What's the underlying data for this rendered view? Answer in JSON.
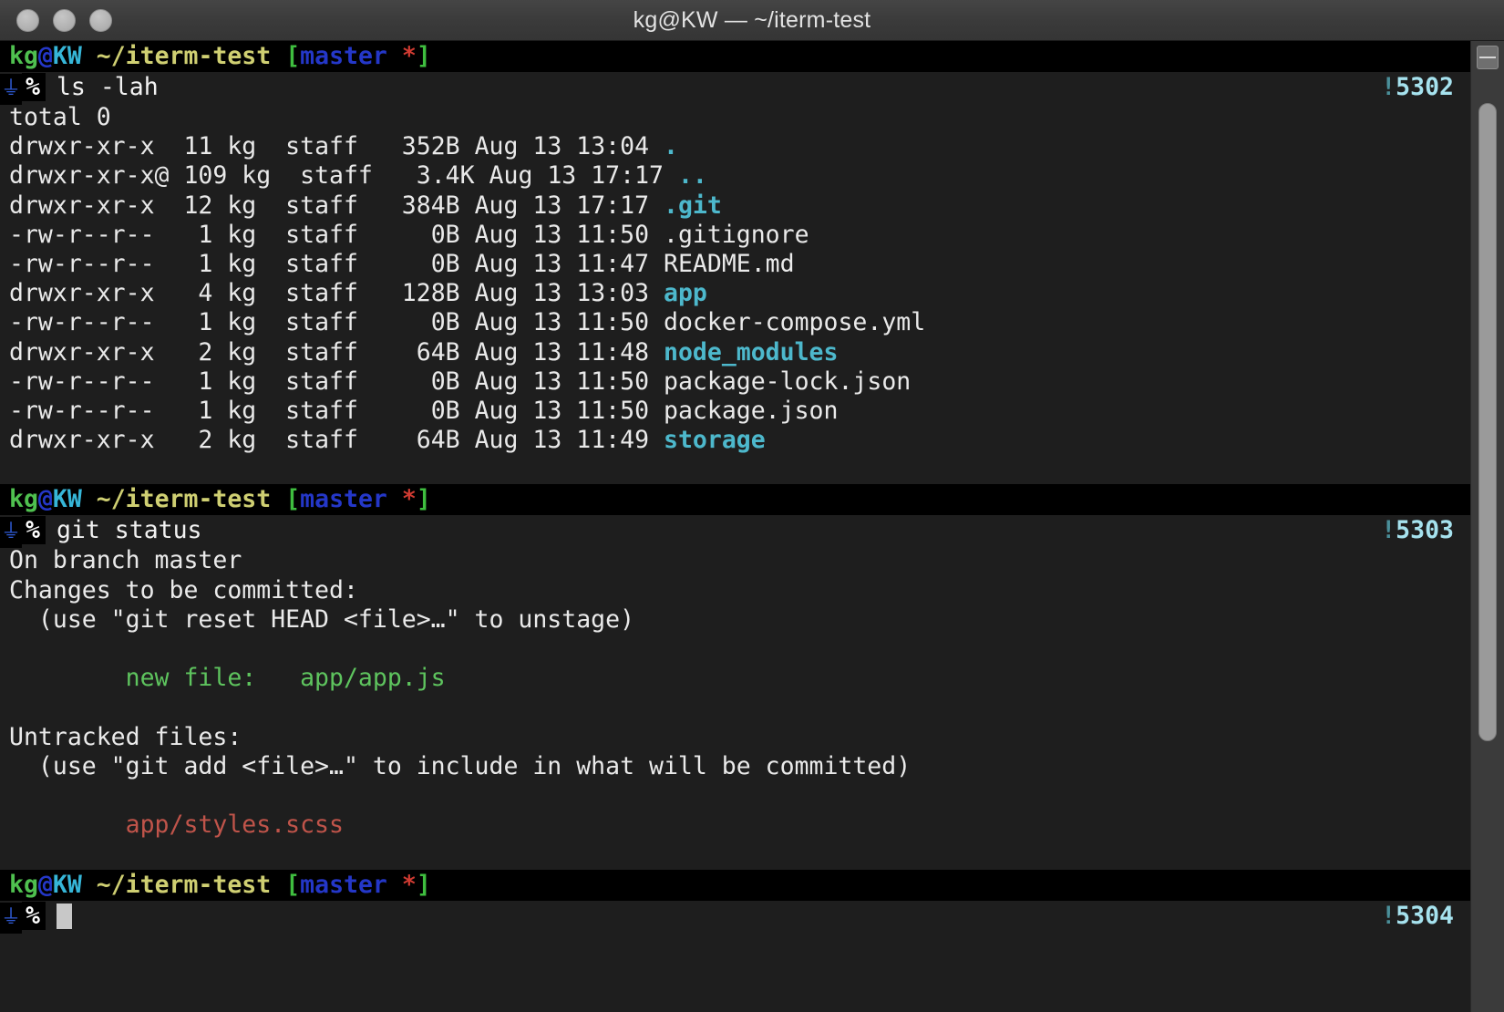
{
  "window": {
    "title": "kg@KW — ~/iterm-test",
    "traffic_lights": [
      "close",
      "minimize",
      "zoom"
    ]
  },
  "theme": {
    "titlebar_bg": "#3a3a3a",
    "terminal_bg": "#1e1e1e",
    "prompt_bg": "#000000",
    "foreground": "#e9e9e9",
    "dir_color": "#4db8cc",
    "green": "#5ec45e",
    "red": "#c0544a",
    "badge_color": "#a6e2ee",
    "cursor_color": "#c8c8c8"
  },
  "prompt": {
    "user": "kg",
    "at": "@",
    "host": "KW",
    "path": "~/iterm-test",
    "bracket_open": "[",
    "branch": "master",
    "dirty": "*",
    "bracket_close": "]",
    "mark": "⏚",
    "symbol": "%"
  },
  "blocks": [
    {
      "command": "ls -lah",
      "badge_bang": "!",
      "badge_num": "5302",
      "output": [
        {
          "text": "total 0",
          "color": "default"
        },
        {
          "perm": "drwxr-xr-x",
          "links": " 11",
          "user": "kg",
          "group": "staff",
          "size": " 352B",
          "date": "Aug 13 13:04",
          "name": ".",
          "name_color": "dir"
        },
        {
          "perm": "drwxr-xr-x@",
          "links": "109",
          "user": "kg",
          "group": "staff",
          "size": " 3.4K",
          "date": "Aug 13 17:17",
          "name": "..",
          "name_color": "dir"
        },
        {
          "perm": "drwxr-xr-x",
          "links": " 12",
          "user": "kg",
          "group": "staff",
          "size": " 384B",
          "date": "Aug 13 17:17",
          "name": ".git",
          "name_color": "dir"
        },
        {
          "perm": "-rw-r--r--",
          "links": "  1",
          "user": "kg",
          "group": "staff",
          "size": "   0B",
          "date": "Aug 13 11:50",
          "name": ".gitignore",
          "name_color": "file"
        },
        {
          "perm": "-rw-r--r--",
          "links": "  1",
          "user": "kg",
          "group": "staff",
          "size": "   0B",
          "date": "Aug 13 11:47",
          "name": "README.md",
          "name_color": "file"
        },
        {
          "perm": "drwxr-xr-x",
          "links": "  4",
          "user": "kg",
          "group": "staff",
          "size": " 128B",
          "date": "Aug 13 13:03",
          "name": "app",
          "name_color": "dir"
        },
        {
          "perm": "-rw-r--r--",
          "links": "  1",
          "user": "kg",
          "group": "staff",
          "size": "   0B",
          "date": "Aug 13 11:50",
          "name": "docker-compose.yml",
          "name_color": "file"
        },
        {
          "perm": "drwxr-xr-x",
          "links": "  2",
          "user": "kg",
          "group": "staff",
          "size": "  64B",
          "date": "Aug 13 11:48",
          "name": "node_modules",
          "name_color": "dir"
        },
        {
          "perm": "-rw-r--r--",
          "links": "  1",
          "user": "kg",
          "group": "staff",
          "size": "   0B",
          "date": "Aug 13 11:50",
          "name": "package-lock.json",
          "name_color": "file"
        },
        {
          "perm": "-rw-r--r--",
          "links": "  1",
          "user": "kg",
          "group": "staff",
          "size": "   0B",
          "date": "Aug 13 11:50",
          "name": "package.json",
          "name_color": "file"
        },
        {
          "perm": "drwxr-xr-x",
          "links": "  2",
          "user": "kg",
          "group": "staff",
          "size": "  64B",
          "date": "Aug 13 11:49",
          "name": "storage",
          "name_color": "dir"
        }
      ]
    },
    {
      "command": "git status",
      "badge_bang": "!",
      "badge_num": "5303",
      "output": [
        {
          "text": "On branch master",
          "color": "default"
        },
        {
          "text": "Changes to be committed:",
          "color": "default"
        },
        {
          "text": "  (use \"git reset HEAD <file>…\" to unstage)",
          "color": "default"
        },
        {
          "text": "",
          "color": "default"
        },
        {
          "text": "        new file:   app/app.js",
          "color": "green"
        },
        {
          "text": "",
          "color": "default"
        },
        {
          "text": "Untracked files:",
          "color": "default"
        },
        {
          "text": "  (use \"git add <file>…\" to include in what will be committed)",
          "color": "default"
        },
        {
          "text": "",
          "color": "default"
        },
        {
          "text": "        app/styles.scss",
          "color": "red"
        }
      ]
    },
    {
      "command": "",
      "badge_bang": "!",
      "badge_num": "5304",
      "output": []
    }
  ]
}
